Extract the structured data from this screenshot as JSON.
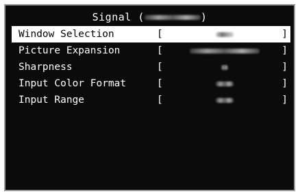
{
  "osd": {
    "title": "Signal (",
    "title_suffix": ")",
    "items": [
      {
        "label": "Window Selection",
        "open": "[",
        "close": "]",
        "selected": true
      },
      {
        "label": "Picture Expansion",
        "open": "[",
        "close": "]",
        "selected": false
      },
      {
        "label": "Sharpness",
        "open": "[",
        "close": "]",
        "selected": false
      },
      {
        "label": "Input Color Format",
        "open": "[",
        "close": "]",
        "selected": false
      },
      {
        "label": "Input Range",
        "open": "[",
        "close": "]",
        "selected": false
      }
    ]
  }
}
